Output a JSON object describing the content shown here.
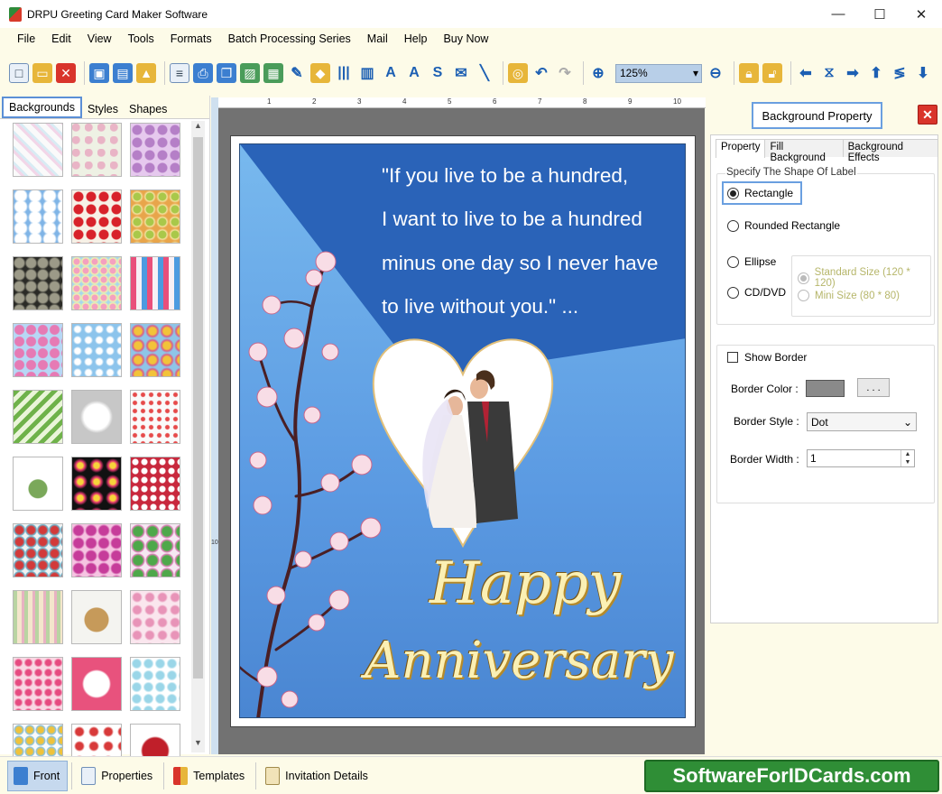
{
  "window": {
    "title": "DRPU Greeting Card Maker Software",
    "minimize": "—",
    "maximize": "☐",
    "close": "✕"
  },
  "menu": [
    "File",
    "Edit",
    "View",
    "Tools",
    "Formats",
    "Batch Processing Series",
    "Mail",
    "Help",
    "Buy Now"
  ],
  "toolbar": {
    "zoom": "125%"
  },
  "left_panel": {
    "tabs": [
      "Backgrounds",
      "Styles",
      "Shapes"
    ],
    "active_tab": "Backgrounds"
  },
  "ruler": {
    "top_numbers": [
      "1",
      "2",
      "3",
      "4",
      "5",
      "6",
      "7",
      "8",
      "9",
      "10",
      "11"
    ],
    "left_number": "10"
  },
  "card": {
    "quote_lines": [
      "\"If you live to be a hundred,",
      "I want to live to be a hundred",
      "minus one day so I never have",
      "to live without you.\" ..."
    ],
    "heading_1": "Happy",
    "heading_2": "Anniversary"
  },
  "right_panel": {
    "title": "Background Property",
    "tabs": [
      "Property",
      "Fill Background",
      "Background Effects"
    ],
    "shape_group_label": "Specify The Shape Of Label",
    "shapes": [
      "Rectangle",
      "Rounded Rectangle",
      "Ellipse",
      "CD/DVD"
    ],
    "selected_shape": "Rectangle",
    "size_options": [
      "Standard Size (120 * 120)",
      "Mini Size (80 * 80)"
    ],
    "show_border_label": "Show Border",
    "show_border_checked": false,
    "border_color_label": "Border Color :",
    "border_color_value": "#8a8a8a",
    "border_color_button": ". . .",
    "border_style_label": "Border Style :",
    "border_style_value": "Dot",
    "border_width_label": "Border Width :",
    "border_width_value": "1"
  },
  "bottom_tabs": [
    "Front",
    "Properties",
    "Templates",
    "Invitation Details"
  ],
  "active_bottom_tab": "Front",
  "brand": "SoftwareForIDCards.com",
  "colors": {
    "app_bg": "#fdfbe8",
    "accent_blue": "#6a9fe0",
    "close_red": "#d9342b",
    "brand_green": "#2f8e36",
    "card_gold": "#fbf0b4"
  }
}
